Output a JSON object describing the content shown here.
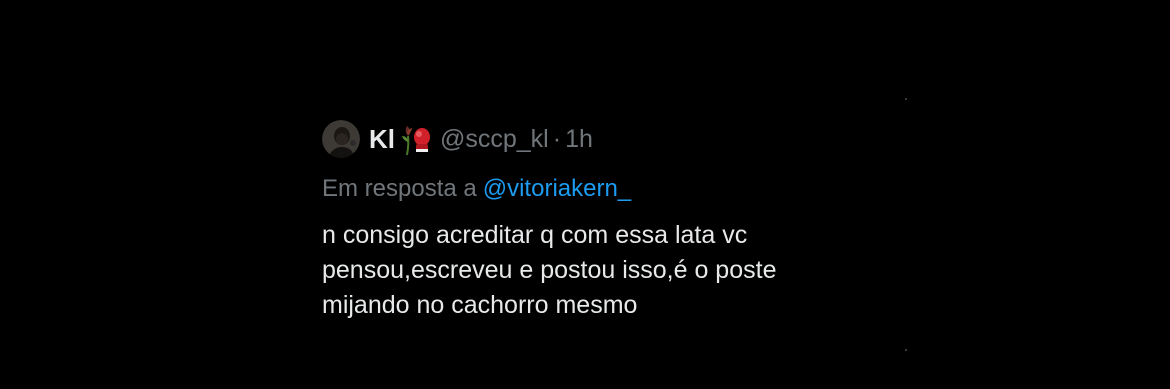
{
  "tweet": {
    "display_name": "Kl",
    "name_emoji_icon": "wilted-rose-boxing-glove-icon",
    "handle": "@sccp_kl",
    "separator": "·",
    "time": "1h",
    "reply_prefix": "Em resposta a",
    "reply_mention": "@vitoriakern_",
    "text": "n consigo acreditar q com essa lata vc\npensou,escreveu e postou isso,é o poste\nmijando no cachorro mesmo"
  },
  "colors": {
    "background": "#000000",
    "primary_text": "#e7e9ea",
    "secondary_text": "#71767b",
    "link": "#1d9bf0"
  }
}
